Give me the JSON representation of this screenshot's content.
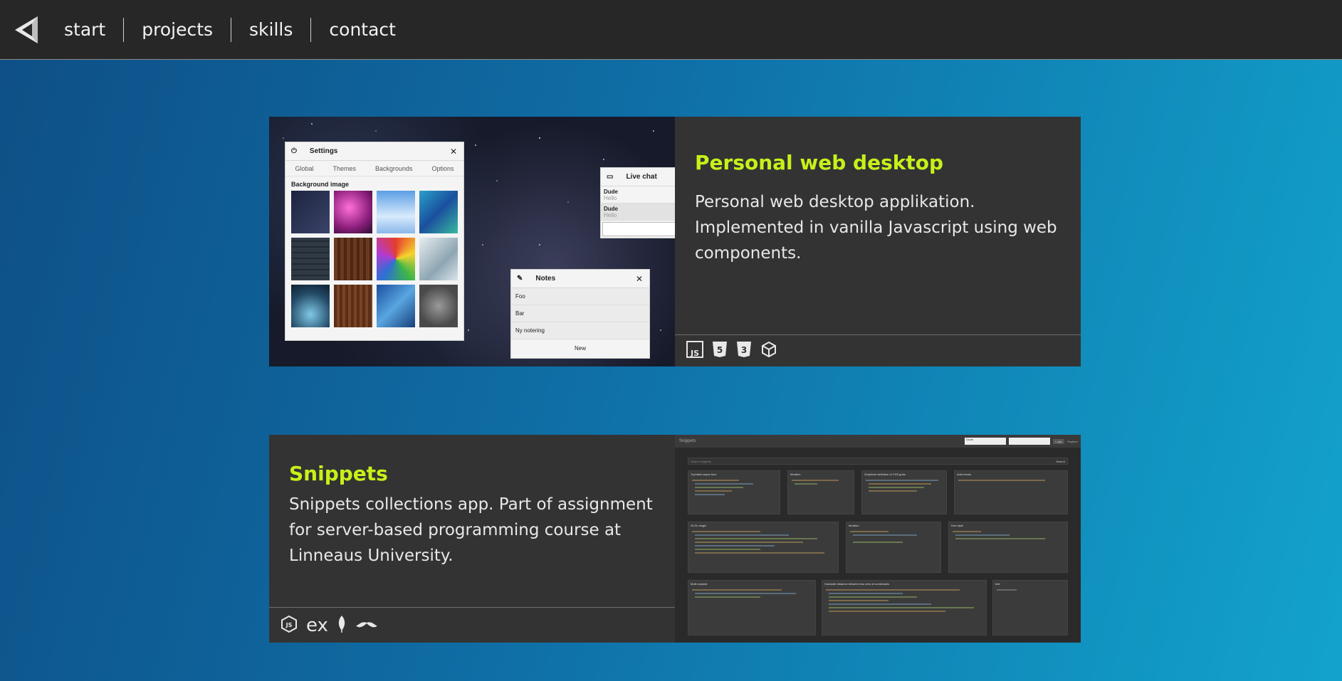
{
  "nav": {
    "logo_icon": "triangle-logo-icon",
    "items": [
      "start",
      "projects",
      "skills",
      "contact"
    ]
  },
  "projects": [
    {
      "title": "Personal web desktop",
      "description": "Personal web desktop applikation. Implemented in vanilla Javascript using web components.",
      "tech_icons": [
        "javascript-icon",
        "html5-icon",
        "css3-icon",
        "codepen-cube-icon"
      ],
      "screenshot": {
        "settings_title": "Settings",
        "settings_tabs": [
          "Global",
          "Themes",
          "Backgrounds",
          "Options"
        ],
        "bg_heading": "Background image",
        "chat_title": "Live chat",
        "chat_messages": [
          {
            "user": "Dude",
            "text": "Hello"
          },
          {
            "user": "Dude",
            "text": "Hello"
          }
        ],
        "notes_title": "Notes",
        "notes": [
          "Foo",
          "Bar",
          "Ny notering"
        ],
        "notes_button": "New"
      }
    },
    {
      "title": "Snippets",
      "description": "Snippets collections app. Part of assignment for server-based programming course at Linneaus University.",
      "tech_icons": [
        "nodejs-icon",
        "express-icon",
        "mongodb-leaf-icon",
        "handlebars-mustache-icon"
      ],
      "screenshot": {
        "app_title": "Snippets",
        "login_user": "Dude",
        "login_button": "Login",
        "register_link": "Register",
        "search_placeholder": "Search snippets",
        "search_button": "Search",
        "snippet_titles": [
          "Try/catch async func",
          "Iteration",
          "Graphical definition of CSS grids",
          "Auto-boxes",
          "GLSL magic",
          "Iteration",
          "Hue-style",
          "Multi explode",
          "Calculate distance between two sets of coordinates",
          "test"
        ]
      }
    }
  ],
  "colors": {
    "accent": "#c6f11a",
    "card_bg": "#333333",
    "topbar_bg": "#272727",
    "bg_gradient_start": "#0e4f86",
    "bg_gradient_end": "#12a3cc"
  }
}
